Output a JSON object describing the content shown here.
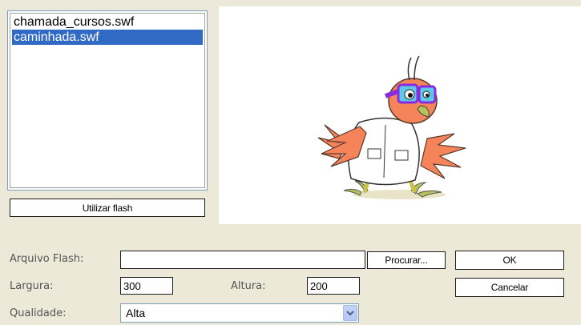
{
  "file_list": {
    "items": [
      {
        "label": "chamada_cursos.swf",
        "selected": false
      },
      {
        "label": "caminhada.swf",
        "selected": true
      }
    ]
  },
  "use_flash_button": "Utilizar flash",
  "preview": {
    "image": "cartoon-bird-with-glasses-and-lab-coat"
  },
  "form": {
    "flash_file_label": "Arquivo Flash:",
    "flash_file_value": "",
    "browse_button": "Procurar...",
    "width_label": "Largura:",
    "width_value": "300",
    "height_label": "Altura:",
    "height_value": "200",
    "quality_label": "Qualidade:",
    "quality_value": "Alta"
  },
  "ok_button": "OK",
  "cancel_button": "Cancelar",
  "colors": {
    "selection": "#316ac5",
    "window_bg": "#ece9d8"
  }
}
